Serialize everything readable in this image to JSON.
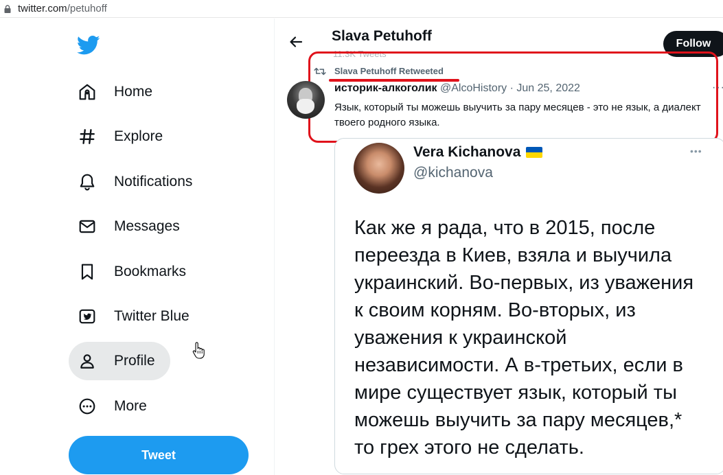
{
  "browser": {
    "host": "twitter.com",
    "path": "/petuhoff"
  },
  "sidebar": {
    "items": [
      {
        "label": "Home",
        "icon": "home-icon"
      },
      {
        "label": "Explore",
        "icon": "hashtag-icon"
      },
      {
        "label": "Notifications",
        "icon": "bell-icon"
      },
      {
        "label": "Messages",
        "icon": "envelope-icon"
      },
      {
        "label": "Bookmarks",
        "icon": "bookmark-icon"
      },
      {
        "label": "Twitter Blue",
        "icon": "twitter-blue-icon"
      },
      {
        "label": "Profile",
        "icon": "profile-icon"
      },
      {
        "label": "More",
        "icon": "more-circle-icon"
      }
    ],
    "tweet_label": "Tweet"
  },
  "header": {
    "name": "Slava Petuhoff",
    "tweet_count": "11.3K Tweets",
    "follow_label": "Follow"
  },
  "retweet": {
    "label": "Slava Petuhoff Retweeted"
  },
  "tweet": {
    "author": "историк-алкоголик",
    "handle": "@AlcoHistory",
    "separator": "·",
    "date": "Jun 25, 2022",
    "text": "Язык, который ты можешь выучить за пару  месяцев - это не язык, а диалект твоего родного языка."
  },
  "embedded": {
    "name": "Vera Kichanova",
    "handle": "@kichanova",
    "text": "Как же я рада, что в 2015, после переезда в Киев, взяла и выучила украинский. Во-первых, из уважения к своим корням. Во-вторых, из уважения к украинской независимости. А в-третьих, если в мире существует язык, который ты можешь выучить за пару месяцев,* то грех этого не сделать."
  },
  "colors": {
    "accent": "#1d9bf0",
    "highlight": "#e0121b",
    "text": "#0f1419",
    "muted": "#536471"
  }
}
